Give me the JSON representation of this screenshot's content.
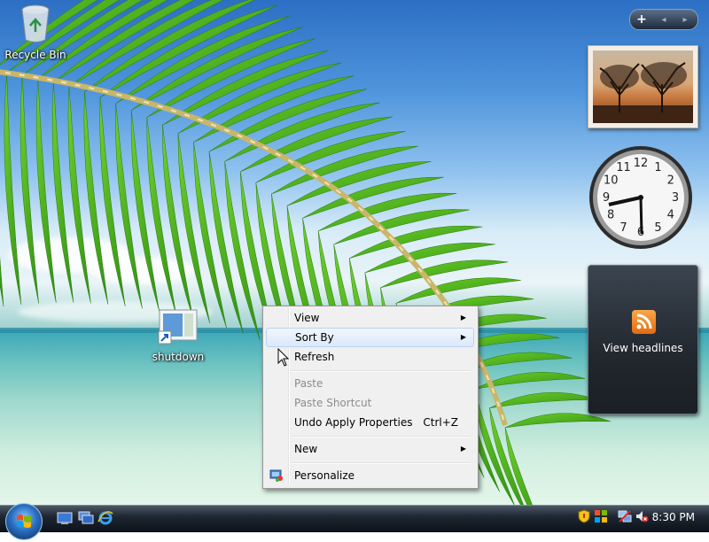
{
  "desktop": {
    "icons": [
      {
        "label": "Recycle Bin",
        "icon": "recycle-bin-icon"
      },
      {
        "label": "shutdown",
        "icon": "shortcut-icon"
      }
    ]
  },
  "sidebar": {
    "controls": [
      "+",
      "◂",
      "▸"
    ],
    "feed_label": "View headlines",
    "clock_numbers": [
      "12",
      "1",
      "2",
      "3",
      "4",
      "5",
      "6",
      "7",
      "8",
      "9",
      "10",
      "11"
    ]
  },
  "context_menu": {
    "items": [
      {
        "label": "View",
        "submenu": true
      },
      {
        "label": "Sort By",
        "submenu": true,
        "highlighted": true
      },
      {
        "label": "Refresh"
      },
      {
        "label": "Paste",
        "disabled": true
      },
      {
        "label": "Paste Shortcut",
        "disabled": true
      },
      {
        "label": "Undo Apply Properties",
        "shortcut": "Ctrl+Z"
      },
      {
        "label": "New",
        "submenu": true
      },
      {
        "label": "Personalize",
        "icon": "personalize-icon"
      }
    ]
  },
  "taskbar": {
    "quick_launch": [
      "show-desktop-icon",
      "switch-windows-icon",
      "internet-explorer-icon"
    ],
    "tray_icons": [
      "security-shield-icon",
      "network-icon",
      "volume-muted-icon"
    ],
    "time": "8:30 PM"
  },
  "colors": {
    "menu_highlight": "#dbe9fa",
    "taskbar": "#1e2732",
    "rss": "#f8a84a"
  }
}
